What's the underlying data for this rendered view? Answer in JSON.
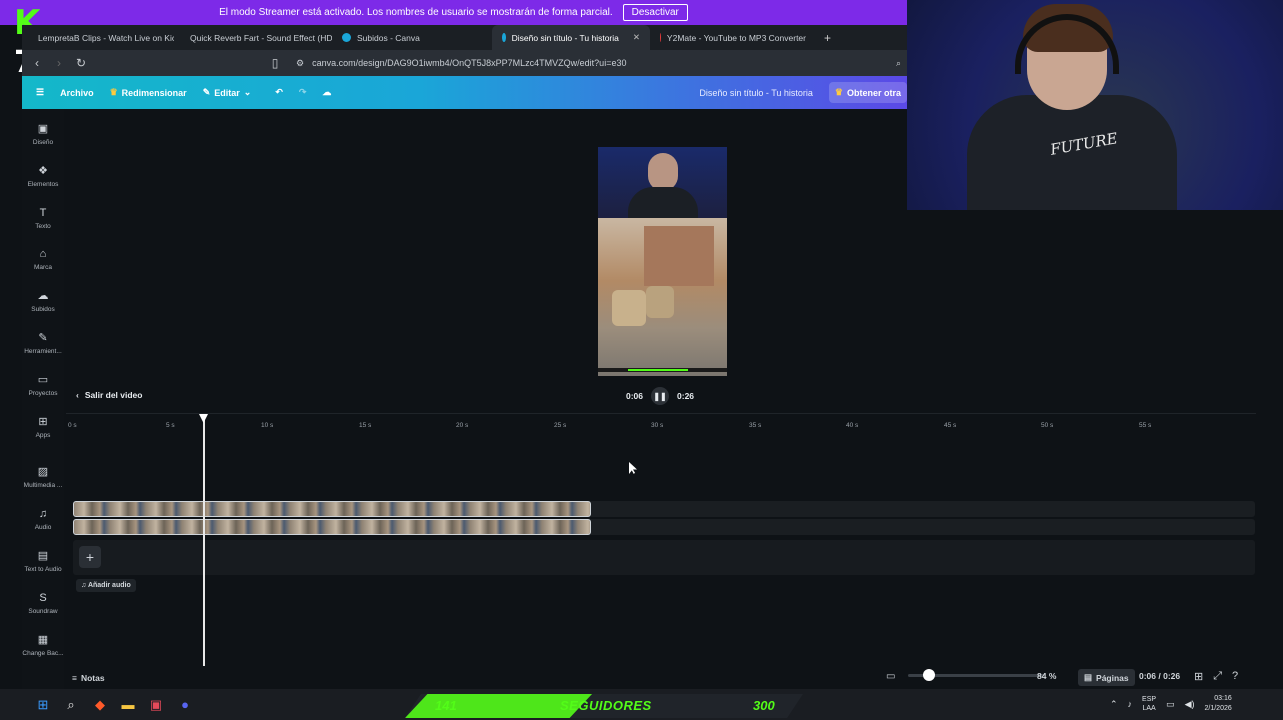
{
  "banner": {
    "text": "El modo Streamer está activado. Los nombres de usuario se mostrarán de forma parcial.",
    "button": "Desactivar"
  },
  "overlay": {
    "kick_letter": "K",
    "kick_number": "7"
  },
  "tabs": [
    {
      "label": "LempretaB Clips - Watch Live on Kick",
      "color": "#53fc18",
      "active": false
    },
    {
      "label": "Quick Reverb Fart - Sound Effect (HD",
      "color": "#e62117",
      "active": false
    },
    {
      "label": "Subidos - Canva",
      "color": "#1aa6d8",
      "active": false
    },
    {
      "label": "Diseño sin título - Tu historia",
      "color": "#1aa6d8",
      "active": true
    },
    {
      "label": "Y2Mate - YouTube to MP3 Converter",
      "color": "#e03a3a",
      "active": false
    }
  ],
  "newtab": "+",
  "address": {
    "url": "canva.com/design/DAG9O1iwmb4/OnQT5J8xPP7MLzc4TMVZQw/edit?ui=e30"
  },
  "canva_header": {
    "archivo": "Archivo",
    "redimensionar": "Redimensionar",
    "editar": "Editar",
    "doc_name": "Diseño sin título - Tu historia",
    "obtener": "Obtener otra"
  },
  "rail": [
    {
      "label": "Diseño",
      "icon": "layout-icon"
    },
    {
      "label": "Elementos",
      "icon": "shapes-icon"
    },
    {
      "label": "Texto",
      "icon": "text-icon"
    },
    {
      "label": "Marca",
      "icon": "brand-icon"
    },
    {
      "label": "Subidos",
      "icon": "cloud-upload-icon"
    },
    {
      "label": "Herramient...",
      "icon": "pen-tool-icon"
    },
    {
      "label": "Proyectos",
      "icon": "folder-icon"
    },
    {
      "label": "Apps",
      "icon": "apps-icon"
    },
    {
      "label": "Multimedia ...",
      "icon": "media-icon"
    },
    {
      "label": "Audio",
      "icon": "music-icon"
    },
    {
      "label": "Text to Audio",
      "icon": "tts-icon"
    },
    {
      "label": "Soundraw",
      "icon": "soundraw-icon"
    },
    {
      "label": "Change Bac...",
      "icon": "change-bg-icon"
    }
  ],
  "webcam": {
    "shirt_text": "FUTURE"
  },
  "video": {
    "exit_label": "Salir del video",
    "current": "0:06",
    "total": "0:26"
  },
  "ruler": [
    "0 s",
    "5 s",
    "10 s",
    "15 s",
    "20 s",
    "25 s",
    "30 s",
    "35 s",
    "40 s",
    "45 s",
    "50 s",
    "55 s"
  ],
  "timeline": {
    "add_audio": "Añadir audio",
    "plus": "+"
  },
  "bottom": {
    "notas": "Notas",
    "zoom": "84 %",
    "paginas": "Páginas",
    "time": "0:06 / 0:26"
  },
  "followers": {
    "current": "141",
    "label": "SEGUIDORES",
    "goal": "300",
    "progress": 0.47
  },
  "tray": {
    "lang1": "ESP",
    "lang2": "LAA",
    "time": "03:16",
    "date": "2/1/2026"
  }
}
